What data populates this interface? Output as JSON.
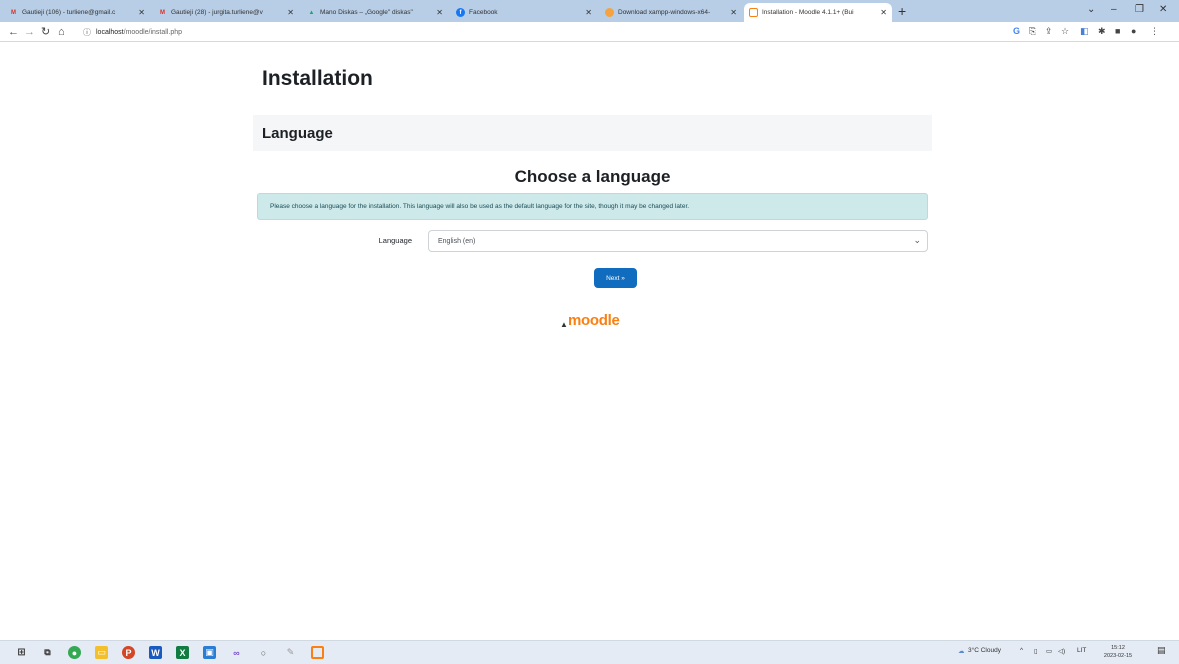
{
  "browser": {
    "tabs": [
      {
        "title": "Gautieji (106) - turliene@gmail.c",
        "icon": "gmail-icon"
      },
      {
        "title": "Gautieji (28) - jurgita.turliene@v",
        "icon": "gmail-icon"
      },
      {
        "title": "Mano Diskas – „Google\" diskas\"",
        "icon": "google-drive-icon"
      },
      {
        "title": "Facebook",
        "icon": "facebook-icon"
      },
      {
        "title": "Download xampp-windows-x64-",
        "icon": "sourceforge-icon"
      },
      {
        "title": "Installation - Moodle 4.1.1+ (Bui",
        "icon": "moodle-icon"
      }
    ],
    "new_tab": "+",
    "url_host": "localhost",
    "url_path": "/moodle/install.php"
  },
  "page": {
    "title": "Installation",
    "section": "Language",
    "heading": "Choose a language",
    "alert": "Please choose a language for the installation. This language will also be used as the default language for the site, though it may be changed later.",
    "language_label": "Language",
    "language_value": "English (en)",
    "next_button": "Next »",
    "logo_text": "moodle"
  },
  "taskbar": {
    "weather": "3°C Cloudy",
    "lang": "LIT",
    "time": "15:12",
    "date": "2023-02-15"
  },
  "colors": {
    "primary": "#0f6cbf",
    "moodle_orange": "#f98012",
    "alert_bg": "#cde9ea",
    "tabstrip_bg": "#b8cde6"
  }
}
